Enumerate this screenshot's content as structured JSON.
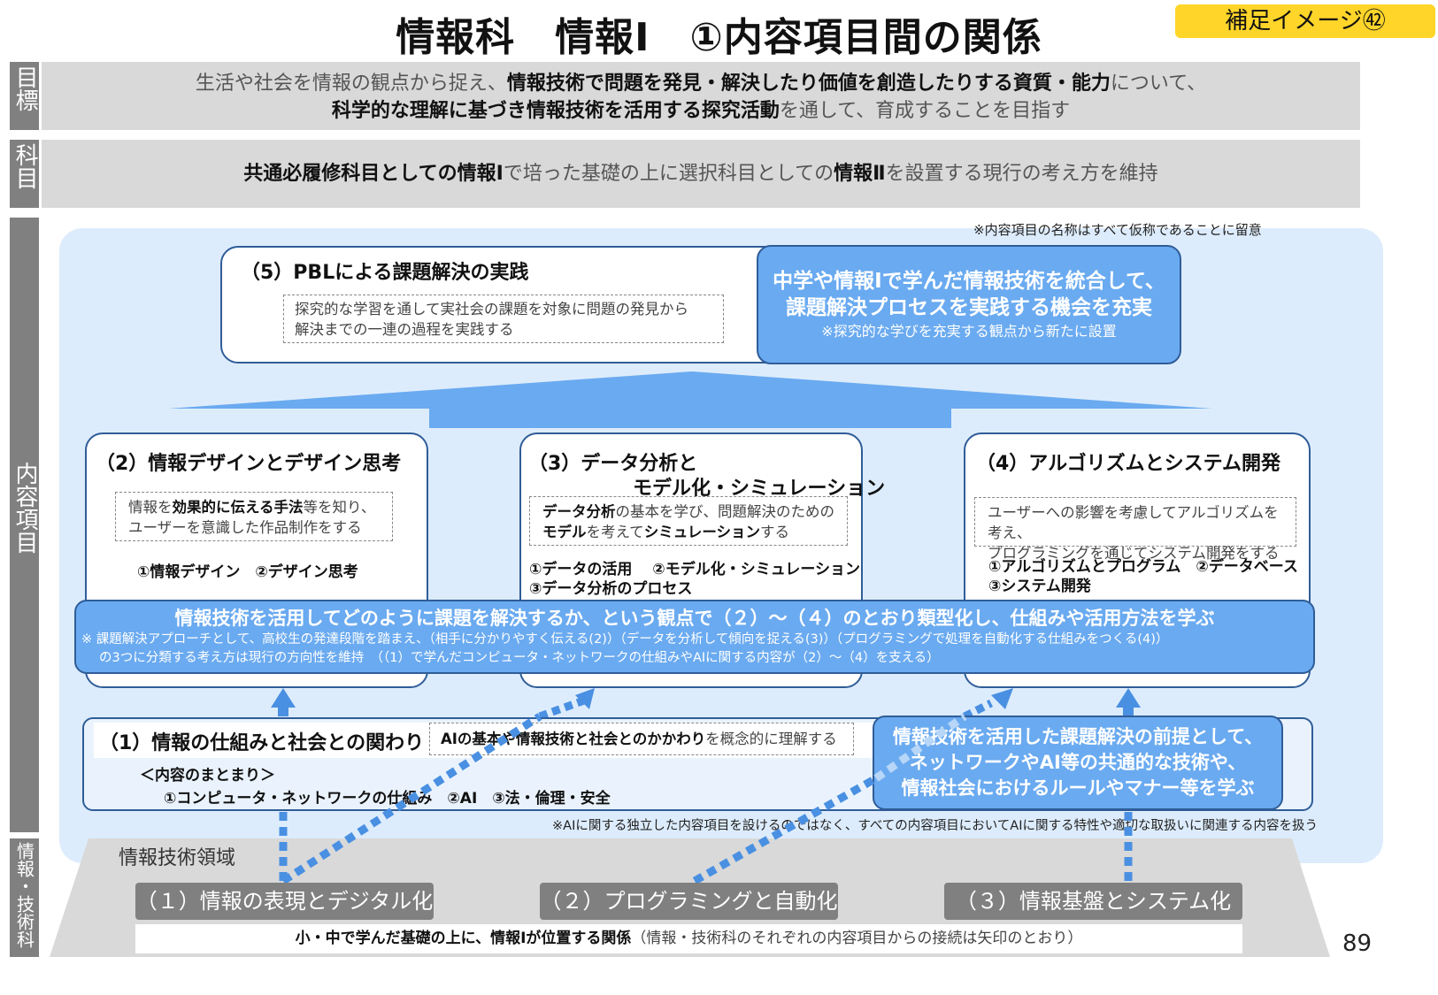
{
  "page_title": "情報科　情報Ⅰ　①内容項目間の関係",
  "badge": "補足イメージ㊷",
  "goal": {
    "label": "目標",
    "line1_pre": "生活や社会を情報の観点から捉え、",
    "line1_bold": "情報技術で問題を発見・解決したり価値を創造したりする資質・能力",
    "line1_post": "について、",
    "line2_bold": "科学的な理解に基づき情報技術を活用する探究活動",
    "line2_post": "を通して、育成することを目指す"
  },
  "subject": {
    "label": "科目",
    "bold1": "共通必履修科目としての情報Ⅰ",
    "mid": "で培った基礎の上に選択科目としての",
    "bold2": "情報Ⅱ",
    "post": "を設置する現行の考え方を維持"
  },
  "content": {
    "label": "内容項目",
    "top_note": "※内容項目の名称はすべて仮称であることに留意",
    "bottom_note": "※AIに関する独立した内容項目を設けるのではなく、すべての内容項目においてAIに関する特性や適切な取扱いに関連する内容を扱う",
    "item5": {
      "title": "（5）PBLによる課題解決の実践",
      "desc_line1": "探究的な学習を通して実社会の課題を対象に問題の発見から",
      "desc_line2": "解決までの一連の過程を実践する",
      "highlight_line1": "中学や情報Ⅰで学んだ情報技術を統合して、",
      "highlight_line2": "課題解決プロセスを実践する機会を充実",
      "highlight_note": "※探究的な学びを充実する観点から新たに設置"
    },
    "item2": {
      "title": "（2）情報デザインとデザイン思考",
      "desc1_pre": "情報を",
      "desc1_bold": "効果的に伝える手法",
      "desc1_post": "等を知り、",
      "desc2": "ユーザーを意識した作品制作をする",
      "sub": "①情報デザイン　②デザイン思考"
    },
    "item3": {
      "title_line1": "（3）データ分析と",
      "title_line2": "モデル化・シミュレーション",
      "desc1_bold": "データ分析",
      "desc1_post": "の基本を学び、問題解決のための",
      "desc2_bold1": "モデル",
      "desc2_mid": "を考えて",
      "desc2_bold2": "シミュレーション",
      "desc2_post": "する",
      "sub_line1": "①データの活用　 ②モデル化・シミュレーション",
      "sub_line2": "③データ分析のプロセス"
    },
    "item4": {
      "title": "（4）アルゴリズムとシステム開発",
      "desc_line1": "ユーザーへの影響を考慮してアルゴリズムを考え、",
      "desc_line2": "プログラミングを通じてシステム開発をする",
      "sub_line1": "①アルゴリズムとプログラム　②データベース",
      "sub_line2": "③システム開発"
    },
    "banner": {
      "main": "情報技術を活用してどのように課題を解決するか、という観点で（２）～（４）のとおり類型化し、仕組みや活用方法を学ぶ",
      "note_line1": "※  課題解決アプローチとして、高校生の発達段階を踏まえ、（相手に分かりやすく伝える(2)）（データを分析して傾向を捉える(3)）（プログラミングで処理を自動化する仕組みをつくる(4)）",
      "note_line2": "の3つに分類する考え方は現行の方向性を維持　（（1）で学んだコンピュータ・ネットワークの仕組みやAIに関する内容が（2）～（4）を支える）"
    },
    "item1": {
      "title": "（1）情報の仕組みと社会との関わり",
      "desc_bold": "AIの基本や情報技術と社会とのかかわり",
      "desc_post": "を概念的に理解する",
      "summary_label": "＜内容のまとまり＞",
      "summary": "①コンピュータ・ネットワークの仕組み　②AI　③法・倫理・安全",
      "highlight_line1": "情報技術を活用した課題解決の前提として、",
      "highlight_line2": "ネットワークやAI等の共通的な技術や、",
      "highlight_line3": "情報社会におけるルールやマナー等を学ぶ"
    }
  },
  "tech": {
    "label": "情報・技術科",
    "area_title": "情報技術領域",
    "boxes": [
      "（１）情報の表現とデジタル化",
      "（２）プログラミングと自動化",
      "（３）情報基盤とシステム化"
    ],
    "footer_bold1": "小・中で学んだ基礎の上に、",
    "footer_bold2": "情報Ⅰが位置する関係",
    "footer_post": "（情報・技術科のそれぞれの内容項目からの接続は矢印のとおり）"
  },
  "page_number": "89",
  "colors": {
    "accent_blue": "#6aaaf0",
    "panel_blue": "#ddecfc",
    "border_navy": "#2f5d98",
    "badge_yellow": "#ffd52a",
    "band_grey": "#d9d9d9",
    "label_grey": "#808080"
  }
}
